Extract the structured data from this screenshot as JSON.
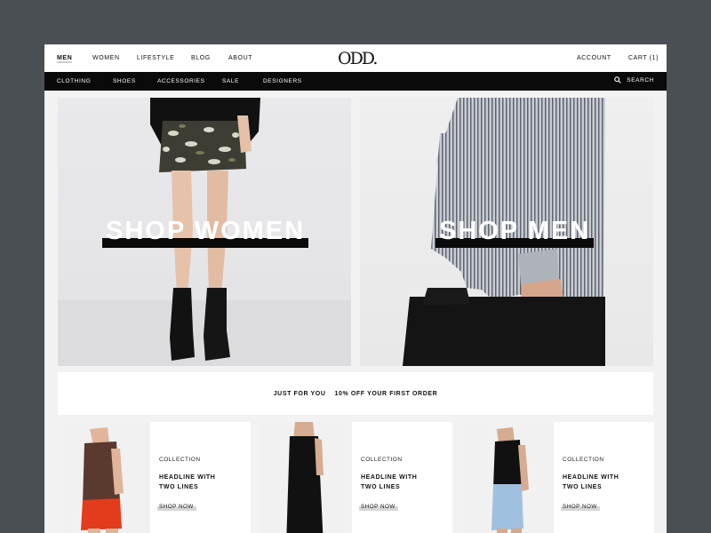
{
  "top_nav": {
    "left": [
      "MEN",
      "WOMEN",
      "LIFESTYLE",
      "BLOG",
      "ABOUT"
    ],
    "logo": "ODD.",
    "right": [
      "ACCOUNT",
      "CART (1)"
    ]
  },
  "category_bar": {
    "items": [
      "CLOTHING",
      "SHOES",
      "ACCESSORIES",
      "SALE",
      "DESIGNERS"
    ],
    "search_label": "SEARCH",
    "search_icon": "search-icon"
  },
  "hero": {
    "women_label": "SHOP WOMEN",
    "men_label": "SHOP MEN"
  },
  "promo": {
    "left": "JUST FOR YOU",
    "right": "10% OFF YOUR FIRST ORDER"
  },
  "cards": [
    {
      "collection": "COLLECTION",
      "headline_1": "HEADLINE WITH",
      "headline_2": "TWO LINES",
      "cta": "SHOP NOW"
    },
    {
      "collection": "COLLECTION",
      "headline_1": "HEADLINE WITH",
      "headline_2": "TWO LINES",
      "cta": "SHOP NOW"
    },
    {
      "collection": "COLLECTION",
      "headline_1": "HEADLINE WITH",
      "headline_2": "TWO LINES",
      "cta": "SHOP NOW"
    }
  ],
  "colors": {
    "backdrop": "#4a4f54",
    "nav_bg": "#ffffff",
    "category_bar_bg": "#0a0a0a",
    "text": "#111111",
    "accent_underline": "#d6d6d6"
  }
}
